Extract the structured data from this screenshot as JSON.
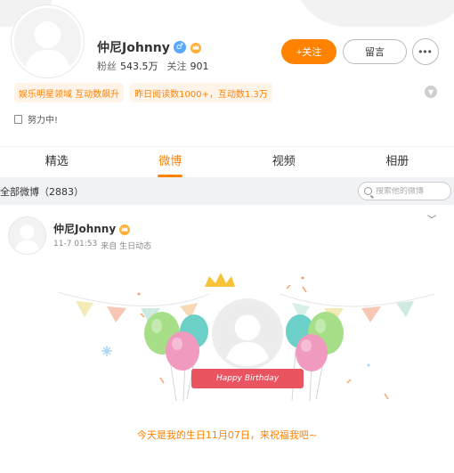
{
  "profile": {
    "username": "仲尼Johnny",
    "stats": [
      {
        "label": "粉丝",
        "value": "543.5万"
      },
      {
        "label": "关注",
        "value": "901"
      }
    ],
    "follow_label": "+关注",
    "message_label": "留言",
    "more_label": "•••",
    "tags": [
      "娱乐明星领域 互动数飙升",
      "昨日阅读数1000+，互动数1.3万"
    ],
    "bio": "努力中!"
  },
  "tabs": [
    {
      "label": "精选",
      "active": false
    },
    {
      "label": "微博",
      "active": true
    },
    {
      "label": "视频",
      "active": false
    },
    {
      "label": "相册",
      "active": false
    }
  ],
  "filter": {
    "label": "全部微博（2883）",
    "search_placeholder": "搜索他的微博"
  },
  "post": {
    "username": "仲尼Johnny",
    "time": "11-7 01:53",
    "source": "来自 生日动态",
    "ribbon_text": "Happy Birthday",
    "text": "今天是我的生日11月07日，来祝福我吧~"
  },
  "colors": {
    "accent": "#ff8200",
    "ribbon": "#e95460",
    "tag_bg": "#fff4ea"
  }
}
